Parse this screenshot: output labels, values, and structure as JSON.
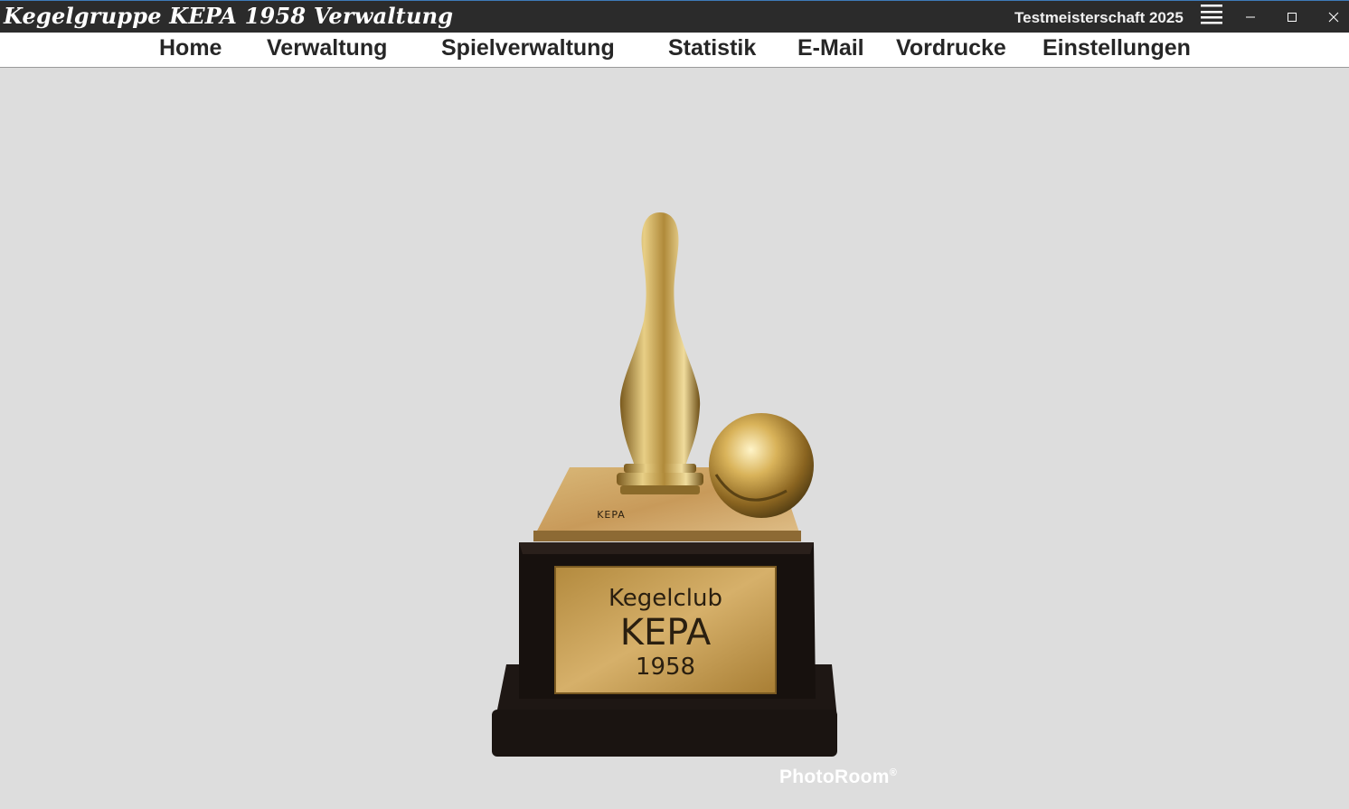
{
  "window": {
    "title": "Kegelgruppe KEPA 1958 Verwaltung",
    "championship": "Testmeisterschaft 2025",
    "controls": [
      "minimize",
      "maximize",
      "close"
    ]
  },
  "menu": {
    "items": [
      {
        "label": "Home"
      },
      {
        "label": "Verwaltung"
      },
      {
        "label": "Spielverwaltung"
      },
      {
        "label": "Statistik"
      },
      {
        "label": "E-Mail"
      },
      {
        "label": "Vordrucke"
      },
      {
        "label": "Einstellungen"
      }
    ]
  },
  "trophy": {
    "top_engraving": "KEPA",
    "plaque_line1": "Kegelclub",
    "plaque_line2": "KEPA",
    "plaque_line3": "1958"
  },
  "watermark": {
    "text": "PhotoRoom",
    "mark": "®"
  },
  "colors": {
    "titlebar": "#2b2b2b",
    "menubar": "#ffffff",
    "background": "#dddddd",
    "gold": "#c9a24a"
  },
  "icons": {
    "menu": "hamburger-icon",
    "minimize": "minimize-icon",
    "maximize": "maximize-icon",
    "close": "close-icon"
  }
}
